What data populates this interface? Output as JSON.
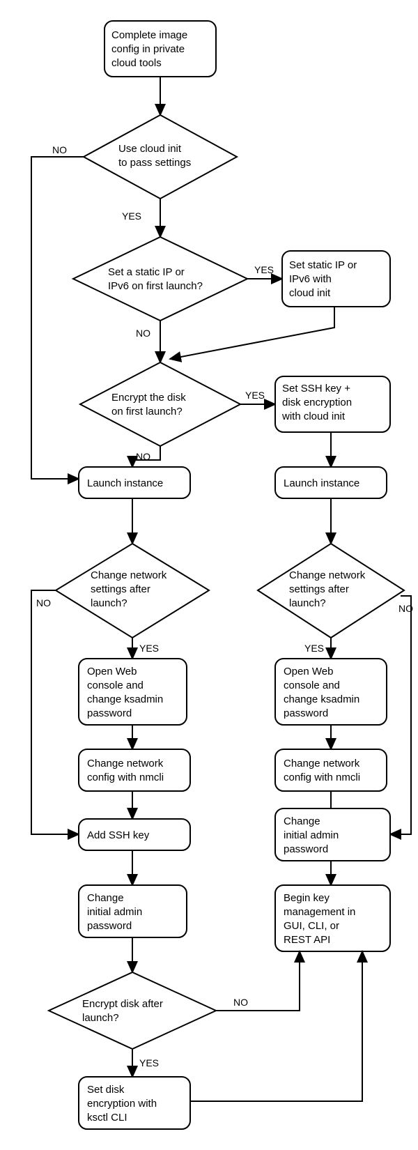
{
  "labels": {
    "yes": "YES",
    "no": "NO"
  },
  "nodes": {
    "start": "Complete image\nconfig in private\ncloud tools",
    "d1": "Use cloud init\nto pass settings",
    "d2": "Set a static IP or\nIPv6 on first launch?",
    "b_setip": "Set static IP or\nIPv6 with\ncloud init",
    "d3": "Encrypt the disk\non first launch?",
    "b_setssh": "Set SSH key +\ndisk encryption\nwith cloud init",
    "b_launchL": "Launch instance",
    "b_launchR": "Launch instance",
    "d4L": "Change network\nsettings after\nlaunch?",
    "d4R": "Change network\nsettings after\nlaunch?",
    "b_openL": "Open Web\nconsole and\nchange ksadmin\npassword",
    "b_openR": "Open Web\nconsole and\nchange ksadmin\npassword",
    "b_nmL": "Change network\nconfig with nmcli",
    "b_nmR": "Change network\nconfig with nmcli",
    "b_addssh": "Add SSH key",
    "b_chgR": "Change\ninitial admin\npassword",
    "b_chgL": "Change\ninitial admin\npassword",
    "b_begin": "Begin key\nmanagement in\nGUI, CLI, or\nREST API",
    "d5": "Encrypt disk after\nlaunch?",
    "b_ksctl": "Set disk\nencryption with\nksctl CLI"
  }
}
